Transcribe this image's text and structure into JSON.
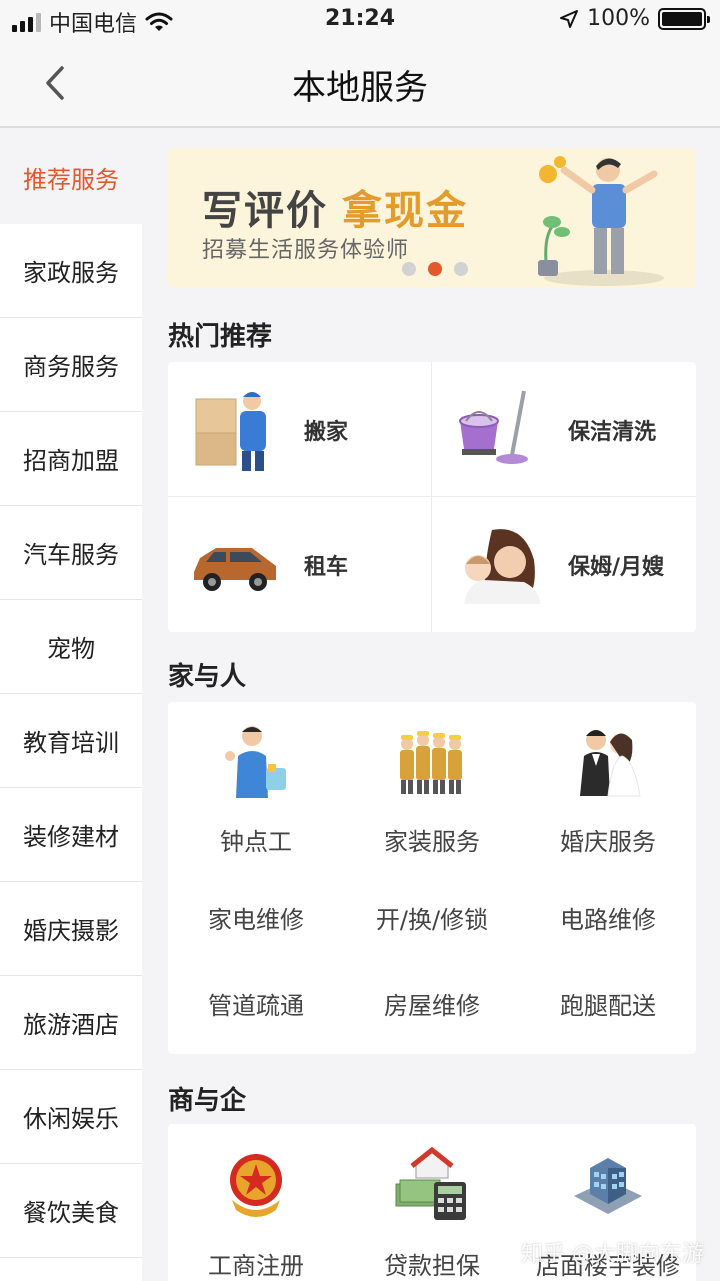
{
  "status_bar": {
    "carrier": "中国电信",
    "time": "21:24",
    "battery": "100%",
    "battery_level": 1.0
  },
  "header": {
    "title": "本地服务",
    "back_icon": "chevron-left-icon"
  },
  "sidebar": {
    "items": [
      {
        "label": "推荐服务",
        "active": true
      },
      {
        "label": "家政服务"
      },
      {
        "label": "商务服务"
      },
      {
        "label": "招商加盟"
      },
      {
        "label": "汽车服务"
      },
      {
        "label": "宠物"
      },
      {
        "label": "教育培训"
      },
      {
        "label": "装修建材"
      },
      {
        "label": "婚庆摄影"
      },
      {
        "label": "旅游酒店"
      },
      {
        "label": "休闲娱乐"
      },
      {
        "label": "餐饮美食"
      }
    ]
  },
  "banner": {
    "title_main": "写评价",
    "title_highlight": "拿现金",
    "subtitle": "招募生活服务体验师",
    "active_slide": 2,
    "slide_count": 3
  },
  "hot": {
    "title": "热门推荐",
    "items": [
      {
        "label": "搬家",
        "icon": "mover-icon"
      },
      {
        "label": "保洁清洗",
        "icon": "mop-bucket-icon"
      },
      {
        "label": "租车",
        "icon": "car-icon"
      },
      {
        "label": "保姆/月嫂",
        "icon": "nanny-icon"
      }
    ]
  },
  "family": {
    "title": "家与人",
    "icon_items": [
      {
        "label": "钟点工",
        "icon": "housekeeper-icon"
      },
      {
        "label": "家装服务",
        "icon": "workers-icon"
      },
      {
        "label": "婚庆服务",
        "icon": "wedding-couple-icon"
      }
    ],
    "text_items": [
      "家电维修",
      "开/换/修锁",
      "电路维修",
      "管道疏通",
      "房屋维修",
      "跑腿配送"
    ]
  },
  "business": {
    "title": "商与企",
    "items": [
      {
        "label": "工商注册",
        "icon": "emblem-icon"
      },
      {
        "label": "贷款担保",
        "icon": "loan-house-calculator-icon"
      },
      {
        "label": "店面楼宇装修",
        "icon": "building-icon"
      }
    ]
  },
  "watermark": "知乎 @大脚向东游",
  "colors": {
    "accent": "#e4592c",
    "banner_bg": "#fcf5dc",
    "banner_highlight": "#e39b2c",
    "page_bg": "#f4f4f6"
  }
}
